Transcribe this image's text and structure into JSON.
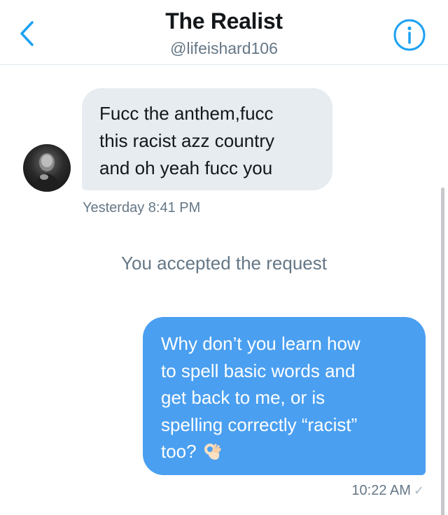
{
  "header": {
    "title": "The Realist",
    "handle": "@lifeishard106",
    "back_icon": "chevron-left-icon",
    "info_icon": "info-circle-icon",
    "accent_color": "#1da1f2"
  },
  "conversation": {
    "incoming": {
      "lines": [
        "Fucc the anthem,fucc",
        "this racist azz country",
        "and oh yeah fucc you"
      ],
      "timestamp": "Yesterday 8:41 PM",
      "bubble_color": "#e6ecf0"
    },
    "system_message": "You accepted the request",
    "outgoing": {
      "lines": [
        "Why don’t you learn how",
        "to spell basic words and",
        "get back to me, or is",
        "spelling correctly “racist”",
        "too?"
      ],
      "emoji": "ok-hand-emoji",
      "timestamp": "10:22 AM",
      "status_icon": "checkmark-icon",
      "bubble_color": "#4a9ff0"
    }
  }
}
